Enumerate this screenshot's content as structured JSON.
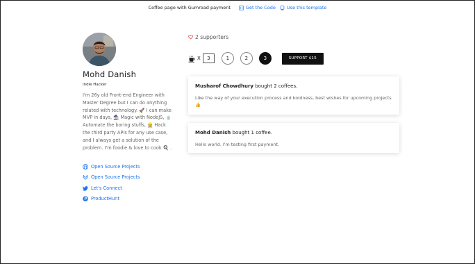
{
  "topbar": {
    "text": "Coffee page with Gumroad payment",
    "get_code": "Get the Code",
    "use_template": "Use this template"
  },
  "profile": {
    "name": "Mohd Danish",
    "role": "Indie Hacker",
    "bio": "I'm 26y old Front-end Engineer with Master Degree but I can do anything related with technology. 🚀 I can make MVP in days, 🧙 Magic with NodeJS, 🍵 Automate the boring stuffs, 👷 Hack the third party APIs for any use case, and I always get a solution of the problem. I'm foodie & love to cook 🍳 .",
    "links": [
      {
        "label": "Open Source Projects",
        "icon": "github-icon"
      },
      {
        "label": "Open Source Projects",
        "icon": "gitlab-icon"
      },
      {
        "label": "Let's Connect",
        "icon": "twitter-icon"
      },
      {
        "label": "ProductHunt",
        "icon": "producthunt-icon"
      }
    ]
  },
  "supporters": {
    "text": "2 supporters",
    "icon": "heart-icon"
  },
  "selector": {
    "times": "X",
    "quantity": "3",
    "options": [
      "1",
      "2",
      "3"
    ],
    "selected": "3",
    "button": "SUPPORT $15"
  },
  "supports": [
    {
      "name": "Musharof Chowdhury",
      "action": " bought 2 coffees.",
      "message": "Like the way of your execution process and boldness, best wishes for upcoming projects 👍"
    },
    {
      "name": "Mohd Danish",
      "action": " bought 1 coffee.",
      "message": "Hello world. I'm testing first payment."
    }
  ],
  "colors": {
    "accent": "#1a73e8",
    "button": "#111111",
    "heart": "#e53935"
  }
}
